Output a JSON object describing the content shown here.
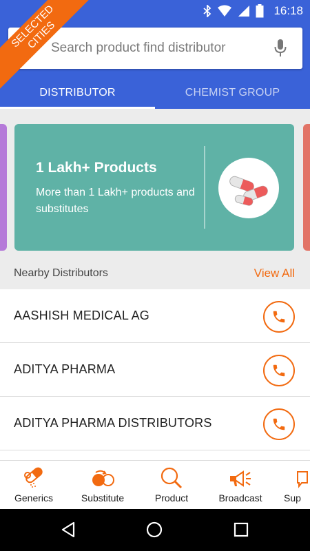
{
  "status_bar": {
    "time": "16:18"
  },
  "ribbon": {
    "line1": "SELECTED",
    "line2": "CITIES"
  },
  "search": {
    "placeholder": "Search product find distributor"
  },
  "tabs": [
    {
      "label": "DISTRIBUTOR",
      "active": true
    },
    {
      "label": "CHEMIST GROUP",
      "active": false
    }
  ],
  "banner": {
    "title": "1 Lakh+ Products",
    "subtitle": "More than 1 Lakh+ products and substitutes",
    "color": "#5fb2a6"
  },
  "nearby": {
    "title": "Nearby Distributors",
    "view_all": "View All",
    "items": [
      {
        "name": "AASHISH MEDICAL AG"
      },
      {
        "name": "ADITYA PHARMA"
      },
      {
        "name": "ADITYA PHARMA DISTRIBUTORS"
      }
    ]
  },
  "bottom_nav": [
    {
      "label": "Generics",
      "icon": "pills-icon"
    },
    {
      "label": "Substitute",
      "icon": "substitute-icon"
    },
    {
      "label": "Product",
      "icon": "search-icon"
    },
    {
      "label": "Broadcast",
      "icon": "megaphone-icon"
    },
    {
      "label": "Sup",
      "icon": "support-icon"
    }
  ],
  "colors": {
    "primary": "#3a62d8",
    "accent": "#f26a10"
  }
}
